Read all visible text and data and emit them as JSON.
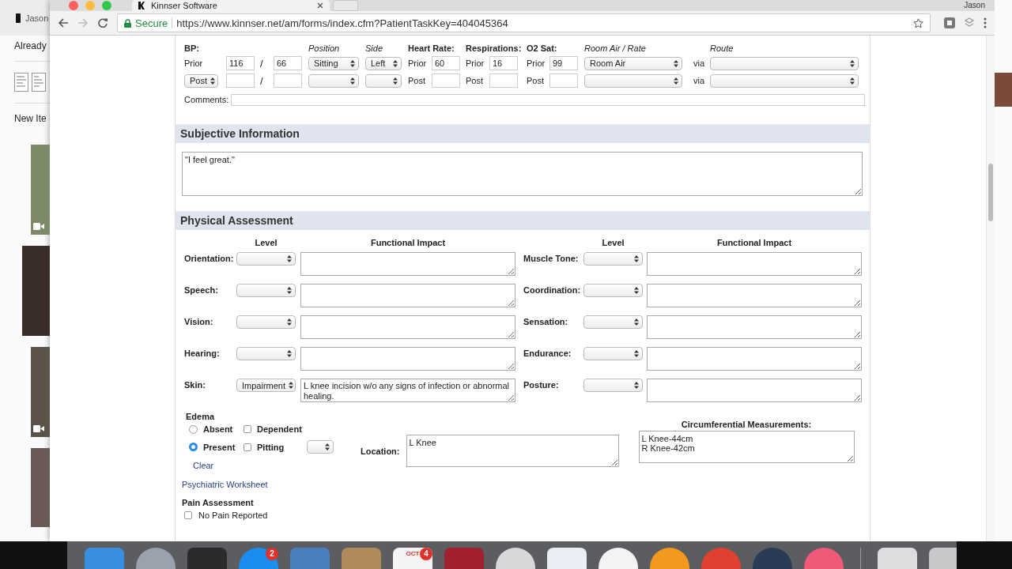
{
  "desktop": {
    "bookmark": "Jason",
    "labels": [
      "Already",
      "New Ite"
    ],
    "photos": [
      {
        "kind": "video"
      },
      {
        "kind": "photo"
      },
      {
        "kind": "video"
      },
      {
        "kind": "photo"
      }
    ]
  },
  "browser": {
    "tab_title": "Kinnser Software",
    "user": "Jason",
    "secure_label": "Secure",
    "url": "https://www.kinnser.net/am/forms/index.cfm?PatientTaskKey=404045364"
  },
  "vitals": {
    "headers": [
      {
        "text": "BP:",
        "kind": "bold"
      },
      {
        "text": "Position",
        "kind": "italic"
      },
      {
        "text": "Side",
        "kind": "italic"
      },
      {
        "text": "Heart Rate:",
        "kind": "bold"
      },
      {
        "text": "Respirations:",
        "kind": "bold"
      },
      {
        "text": "O2 Sat:",
        "kind": "bold"
      },
      {
        "text": "Room Air / Rate",
        "kind": "italic"
      },
      {
        "text": "Route",
        "kind": "italic"
      }
    ],
    "rows": [
      [
        {
          "kind": "label",
          "text": "Prior"
        },
        {
          "kind": "input",
          "value": "116"
        },
        {
          "kind": "slash",
          "text": "/"
        },
        {
          "kind": "input",
          "value": "66"
        },
        {
          "kind": "select",
          "value": "Sitting"
        },
        {
          "kind": "select",
          "value": "Left"
        },
        {
          "kind": "label",
          "text": "Prior"
        },
        {
          "kind": "input",
          "value": "60"
        },
        {
          "kind": "label",
          "text": "Prior"
        },
        {
          "kind": "input",
          "value": "16"
        },
        {
          "kind": "label",
          "text": "Prior"
        },
        {
          "kind": "input",
          "value": "99"
        },
        {
          "kind": "select",
          "value": "Room Air"
        },
        {
          "kind": "label",
          "text": "via"
        },
        {
          "kind": "select"
        }
      ],
      [
        {
          "kind": "select",
          "value": "Post"
        },
        {
          "kind": "input"
        },
        {
          "kind": "slash",
          "text": "/"
        },
        {
          "kind": "input"
        },
        {
          "kind": "select"
        },
        {
          "kind": "select"
        },
        {
          "kind": "label",
          "text": "Post"
        },
        {
          "kind": "input"
        },
        {
          "kind": "label",
          "text": "Post"
        },
        {
          "kind": "input"
        },
        {
          "kind": "label",
          "text": "Post"
        },
        {
          "kind": "input"
        },
        {
          "kind": "select"
        },
        {
          "kind": "label",
          "text": "via"
        },
        {
          "kind": "select"
        }
      ]
    ],
    "comments_label": "Comments:"
  },
  "subjective": {
    "title": "Subjective Information",
    "text": "\"I feel great.\""
  },
  "physical": {
    "title": "Physical Assessment",
    "column_headers": [
      "Level",
      "Functional Impact",
      "Level",
      "Functional Impact"
    ],
    "items": [
      {
        "label": "Orientation:"
      },
      {
        "label": "Muscle Tone:"
      },
      {
        "label": "Speech:"
      },
      {
        "label": "Coordination:"
      },
      {
        "label": "Vision:"
      },
      {
        "label": "Sensation:"
      },
      {
        "label": "Hearing:"
      },
      {
        "label": "Endurance:"
      },
      {
        "label": "Skin:",
        "value": "Impairment",
        "impact": "L knee incision w/o any signs of infection or abnormal healing."
      },
      {
        "label": "Posture:"
      }
    ]
  },
  "edema": {
    "title": "Edema",
    "options": [
      {
        "kind": "radio",
        "label": "Absent",
        "selected": false
      },
      {
        "kind": "checkbox",
        "label": "Dependent",
        "checked": false
      },
      {
        "kind": "radio",
        "label": "Present",
        "selected": true
      },
      {
        "kind": "checkbox",
        "label": "Pitting",
        "checked": false
      },
      {
        "kind": "select"
      }
    ],
    "clear_link": "Clear",
    "location_label": "Location:",
    "location": "L Knee",
    "measurements_label": "Circumferential Measurements:",
    "measurements": "L Knee-44cm\nR Knee-42cm"
  },
  "worksheet_link": "Psychiatric Worksheet",
  "pain": {
    "title": "Pain Assessment",
    "options": [
      {
        "label": "No Pain Reported",
        "checked": false
      }
    ]
  },
  "dock": {
    "items": [
      {
        "kind": "square",
        "color": "#3b8fe0"
      },
      {
        "kind": "circle",
        "color": "#9aa3ad"
      },
      {
        "kind": "square",
        "color": "#2b2b2b"
      },
      {
        "kind": "circle",
        "color": "#1c8df0",
        "badge": "2"
      },
      {
        "kind": "square",
        "color": "#4a7fc0"
      },
      {
        "kind": "square",
        "color": "#b08a5a"
      },
      {
        "kind": "square",
        "color": "#f4f4f4",
        "label": "OCT",
        "badge": "4"
      },
      {
        "kind": "square",
        "color": "#a02030"
      },
      {
        "kind": "circle",
        "color": "#d8d8d8"
      },
      {
        "kind": "square",
        "color": "#e8eef4"
      },
      {
        "kind": "circle",
        "color": "#f3f3f3"
      },
      {
        "kind": "circle",
        "color": "#f39a1e"
      },
      {
        "kind": "circle",
        "color": "#e04030"
      },
      {
        "kind": "circle",
        "color": "#2a3b55"
      },
      {
        "kind": "circle",
        "color": "#f05a78"
      },
      {
        "kind": "divider"
      },
      {
        "kind": "square",
        "color": "#dddddd"
      },
      {
        "kind": "square",
        "color": "#c8c8c8"
      }
    ]
  }
}
